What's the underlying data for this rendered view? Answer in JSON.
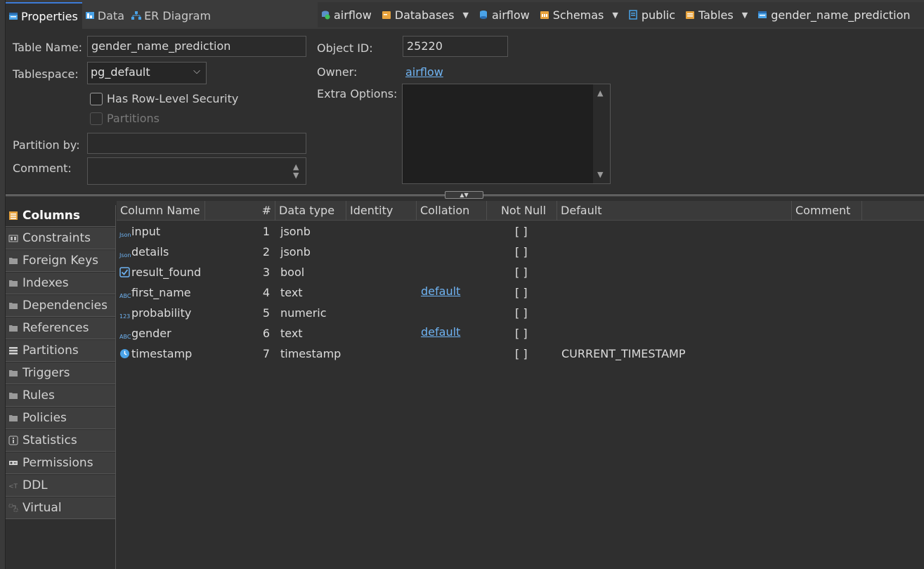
{
  "tabs": [
    {
      "label": "Properties",
      "icon": "properties-icon"
    },
    {
      "label": "Data",
      "icon": "data-icon"
    },
    {
      "label": "ER Diagram",
      "icon": "er-diagram-icon"
    }
  ],
  "breadcrumbs": [
    {
      "label": "airflow",
      "icon": "connection-icon"
    },
    {
      "label": "Databases",
      "icon": "folder-icon"
    },
    {
      "label": "airflow",
      "icon": "database-icon"
    },
    {
      "label": "Schemas",
      "icon": "folder-icon"
    },
    {
      "label": "public",
      "icon": "schema-icon"
    },
    {
      "label": "Tables",
      "icon": "folder-icon"
    },
    {
      "label": "gender_name_prediction",
      "icon": "table-icon"
    }
  ],
  "form": {
    "table_name_label": "Table Name:",
    "table_name_value": "gender_name_prediction",
    "tablespace_label": "Tablespace:",
    "tablespace_value": "pg_default",
    "row_level_security_label": "Has Row-Level Security",
    "partitions_label": "Partitions",
    "partition_by_label": "Partition by:",
    "partition_by_value": "",
    "comment_label": "Comment:",
    "comment_value": "",
    "object_id_label": "Object ID:",
    "object_id_value": "25220",
    "owner_label": "Owner:",
    "owner_value": "airflow",
    "extra_options_label": "Extra Options:",
    "extra_options_value": ""
  },
  "sidenav": [
    {
      "label": "Columns",
      "icon": "columns-icon",
      "active": true
    },
    {
      "label": "Constraints",
      "icon": "constraints-icon"
    },
    {
      "label": "Foreign Keys",
      "icon": "folder-icon"
    },
    {
      "label": "Indexes",
      "icon": "folder-icon"
    },
    {
      "label": "Dependencies",
      "icon": "folder-icon"
    },
    {
      "label": "References",
      "icon": "folder-icon"
    },
    {
      "label": "Partitions",
      "icon": "partitions-icon"
    },
    {
      "label": "Triggers",
      "icon": "folder-icon"
    },
    {
      "label": "Rules",
      "icon": "folder-icon"
    },
    {
      "label": "Policies",
      "icon": "folder-icon"
    },
    {
      "label": "Statistics",
      "icon": "info-icon"
    },
    {
      "label": "Permissions",
      "icon": "key-icon"
    },
    {
      "label": "DDL",
      "icon": "ddl-icon"
    },
    {
      "label": "Virtual",
      "icon": "virtual-icon"
    }
  ],
  "columns_table": {
    "headers": [
      "Column Name",
      "#",
      "Data type",
      "Identity",
      "Collation",
      "Not Null",
      "Default",
      "Comment"
    ],
    "rows": [
      {
        "name": "input",
        "icon": "json-icon",
        "num": "1",
        "type": "jsonb",
        "identity": "",
        "collation": "",
        "not_null": "[ ]",
        "default": "",
        "comment": ""
      },
      {
        "name": "details",
        "icon": "json-icon",
        "num": "2",
        "type": "jsonb",
        "identity": "",
        "collation": "",
        "not_null": "[ ]",
        "default": "",
        "comment": ""
      },
      {
        "name": "result_found",
        "icon": "checkbox-icon",
        "num": "3",
        "type": "bool",
        "identity": "",
        "collation": "",
        "not_null": "[ ]",
        "default": "",
        "comment": ""
      },
      {
        "name": "first_name",
        "icon": "text-type-icon",
        "num": "4",
        "type": "text",
        "identity": "",
        "collation": "default",
        "not_null": "[ ]",
        "default": "",
        "comment": ""
      },
      {
        "name": "probability",
        "icon": "numeric-icon",
        "num": "5",
        "type": "numeric",
        "identity": "",
        "collation": "",
        "not_null": "[ ]",
        "default": "",
        "comment": ""
      },
      {
        "name": "gender",
        "icon": "text-type-icon",
        "num": "6",
        "type": "text",
        "identity": "",
        "collation": "default",
        "not_null": "[ ]",
        "default": "",
        "comment": ""
      },
      {
        "name": "timestamp",
        "icon": "clock-icon",
        "num": "7",
        "type": "timestamp",
        "identity": "",
        "collation": "",
        "not_null": "[ ]",
        "default": "CURRENT_TIMESTAMP",
        "comment": ""
      }
    ]
  },
  "colors": {
    "accent": "#3d7bd6",
    "link": "#6fb3f2",
    "folder": "#e8a33d"
  }
}
